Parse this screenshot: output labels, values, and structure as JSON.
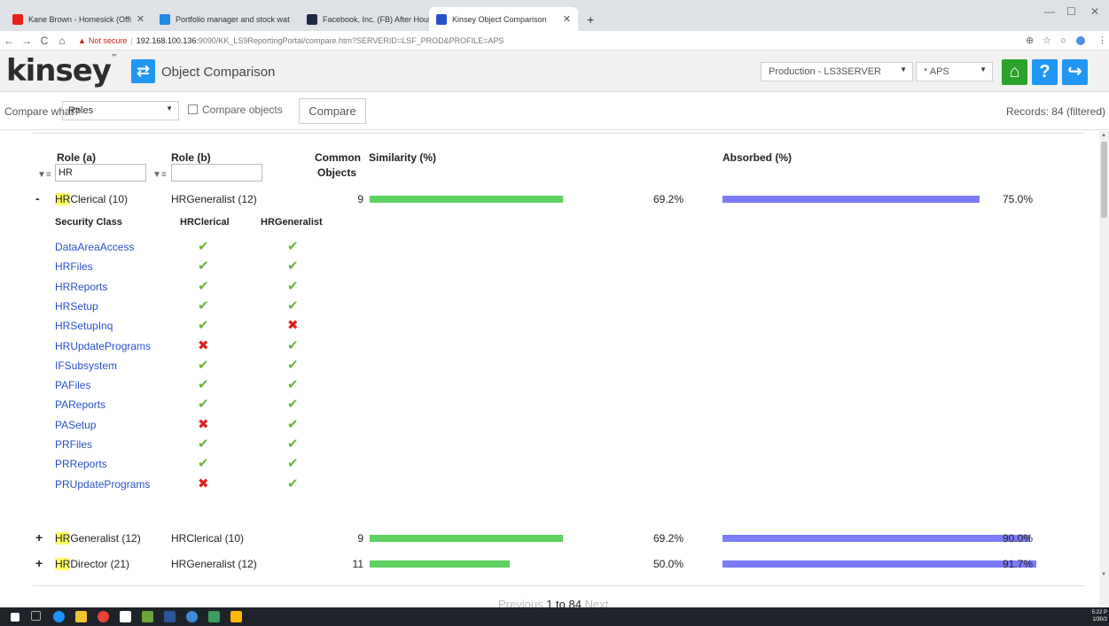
{
  "browser": {
    "tabs": [
      {
        "title": "Kane Brown - Homesick (Offi",
        "icon": "youtube-icon",
        "color": "#e62117"
      },
      {
        "title": "Portfolio manager and stock wat",
        "icon": "portfolio-icon",
        "color": "#1e88e5"
      },
      {
        "title": "Facebook, Inc. (FB) After Hours T",
        "icon": "chart-icon",
        "color": "#1f2a44"
      },
      {
        "title": "Kinsey Object Comparison",
        "icon": "kinsey-icon",
        "color": "#2a50c8"
      }
    ],
    "new_tab": "+",
    "url": {
      "warning": "Not secure",
      "host": "192.168.100.136",
      "rest": ":9090/KK_LS9ReportingPortal/compare.htm?SERVERID=LSF_PROD&PROFILE=APS"
    }
  },
  "app": {
    "logo": "kinsey",
    "title": "Object Comparison",
    "server_select": "Production - LS3SERVER",
    "profile_select": "* APS",
    "home_label": "⌂",
    "help_label": "?",
    "exit_label": "↪"
  },
  "compare_bar": {
    "what_label": "Compare what?",
    "what_value": "Roles",
    "objects_label": "Compare objects",
    "button": "Compare",
    "records": "Records: 84 (filtered)"
  },
  "table": {
    "headers": {
      "role_a": "Role (a)",
      "role_b": "Role (b)",
      "common_1": "Common",
      "common_2": "Objects",
      "similarity": "Similarity (%)",
      "absorbed": "Absorbed (%)"
    },
    "filter_a": "HR",
    "filter_b": "",
    "rows": [
      {
        "expander": "-",
        "role_a_hl": "HR",
        "role_a_rest": "Clerical (10)",
        "role_b": "HRGeneralist (12)",
        "common": "9",
        "similarity_pct": "69.2%",
        "similarity": 0.692,
        "absorbed_pct": "75.0%",
        "absorbed": 0.75
      },
      {
        "expander": "+",
        "role_a_hl": "HR",
        "role_a_rest": "Generalist (12)",
        "role_b": "HRClerical (10)",
        "common": "9",
        "similarity_pct": "69.2%",
        "similarity": 0.692,
        "absorbed_pct": "90.0%",
        "absorbed": 0.9
      },
      {
        "expander": "+",
        "role_a_hl": "HR",
        "role_a_rest": "Director (21)",
        "role_b": "HRGeneralist (12)",
        "common": "11",
        "similarity_pct": "50.0%",
        "similarity": 0.5,
        "absorbed_pct": "91.7%",
        "absorbed": 0.917
      }
    ],
    "detail": {
      "head_class": "Security Class",
      "head_a": "HRClerical",
      "head_b": "HRGeneralist",
      "items": [
        {
          "name": "DataAreaAccess",
          "a": true,
          "b": true
        },
        {
          "name": "HRFiles",
          "a": true,
          "b": true
        },
        {
          "name": "HRReports",
          "a": true,
          "b": true
        },
        {
          "name": "HRSetup",
          "a": true,
          "b": true
        },
        {
          "name": "HRSetupInq",
          "a": true,
          "b": false
        },
        {
          "name": "HRUpdatePrograms",
          "a": false,
          "b": true
        },
        {
          "name": "IFSubsystem",
          "a": true,
          "b": true
        },
        {
          "name": "PAFiles",
          "a": true,
          "b": true
        },
        {
          "name": "PAReports",
          "a": true,
          "b": true
        },
        {
          "name": "PASetup",
          "a": false,
          "b": true
        },
        {
          "name": "PRFiles",
          "a": true,
          "b": true
        },
        {
          "name": "PRReports",
          "a": true,
          "b": true
        },
        {
          "name": "PRUpdatePrograms",
          "a": false,
          "b": true
        }
      ]
    }
  },
  "pager": {
    "prev": "Previous",
    "current": "1 to 84",
    "next": "Next"
  },
  "taskbar": {
    "time": "5:22 P",
    "date": "1/30/2"
  },
  "colors": {
    "similarity_bar": "#5ed160",
    "absorbed_bar": "#7b7bf7",
    "highlight": "#ffff66",
    "link": "#2a50c8"
  }
}
